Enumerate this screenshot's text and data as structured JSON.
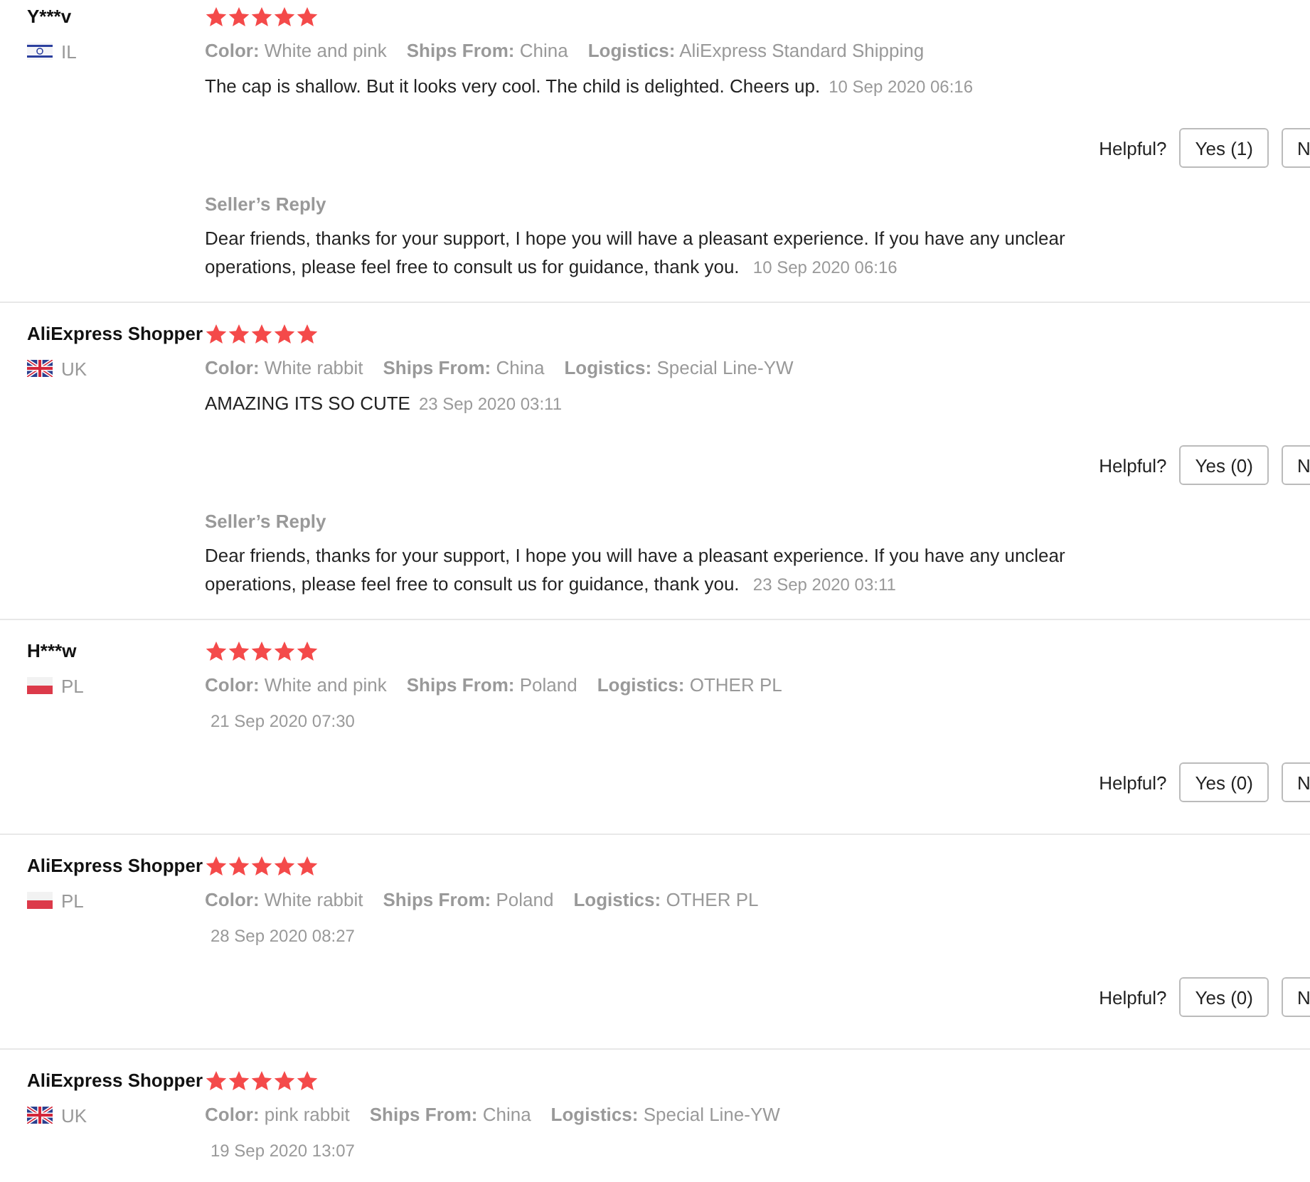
{
  "reviews": [
    {
      "name": "Y***v",
      "kind": "star-stripes",
      "country": "IL",
      "stars": 5,
      "meta": [
        {
          "label": "Color:",
          "value": "White and pink"
        },
        {
          "label": "Ships From:",
          "value": "China"
        },
        {
          "label": "Logistics:",
          "value": "AliExpress Standard Shipping"
        }
      ],
      "text": "The cap is shallow. But it looks very cool. The child is delighted. Cheers up.",
      "date": "10 Sep 2020 06:16",
      "helpful": {
        "label": "Helpful?",
        "yes": "Yes (1)",
        "no": "N"
      },
      "reply": {
        "title": "Seller’s Reply",
        "text": "Dear friends, thanks for your support, I hope you will have a pleasant experience. If you have any unclear operations, please feel free to consult us for guidance, thank you.",
        "date": "10 Sep 2020 06:16"
      }
    },
    {
      "name": "AliExpress Shopper",
      "kind": "union",
      "country": "UK",
      "stars": 5,
      "meta": [
        {
          "label": "Color:",
          "value": "White rabbit"
        },
        {
          "label": "Ships From:",
          "value": "China"
        },
        {
          "label": "Logistics:",
          "value": "Special Line-YW"
        }
      ],
      "text": "AMAZING ITS SO CUTE",
      "date": "23 Sep 2020 03:11",
      "helpful": {
        "label": "Helpful?",
        "yes": "Yes (0)",
        "no": "N"
      },
      "reply": {
        "title": "Seller’s Reply",
        "text": "Dear friends, thanks for your support, I hope you will have a pleasant experience. If you have any unclear operations, please feel free to consult us for guidance, thank you.",
        "date": "23 Sep 2020 03:11"
      }
    },
    {
      "name": "H***w",
      "kind": "white-red",
      "country": "PL",
      "stars": 5,
      "meta": [
        {
          "label": "Color:",
          "value": "White and pink"
        },
        {
          "label": "Ships From:",
          "value": "Poland"
        },
        {
          "label": "Logistics:",
          "value": "OTHER PL"
        }
      ],
      "date": "21 Sep 2020 07:30",
      "helpful": {
        "label": "Helpful?",
        "yes": "Yes (0)",
        "no": "N"
      }
    },
    {
      "name": "AliExpress Shopper",
      "kind": "white-red",
      "country": "PL",
      "stars": 5,
      "meta": [
        {
          "label": "Color:",
          "value": "White rabbit"
        },
        {
          "label": "Ships From:",
          "value": "Poland"
        },
        {
          "label": "Logistics:",
          "value": "OTHER PL"
        }
      ],
      "date": "28 Sep 2020 08:27",
      "helpful": {
        "label": "Helpful?",
        "yes": "Yes (0)",
        "no": "N"
      }
    },
    {
      "name": "AliExpress Shopper",
      "kind": "union",
      "country": "UK",
      "stars": 5,
      "meta": [
        {
          "label": "Color:",
          "value": "pink rabbit"
        },
        {
          "label": "Ships From:",
          "value": "China"
        },
        {
          "label": "Logistics:",
          "value": "Special Line-YW"
        }
      ],
      "date": "19 Sep 2020 13:07"
    }
  ]
}
